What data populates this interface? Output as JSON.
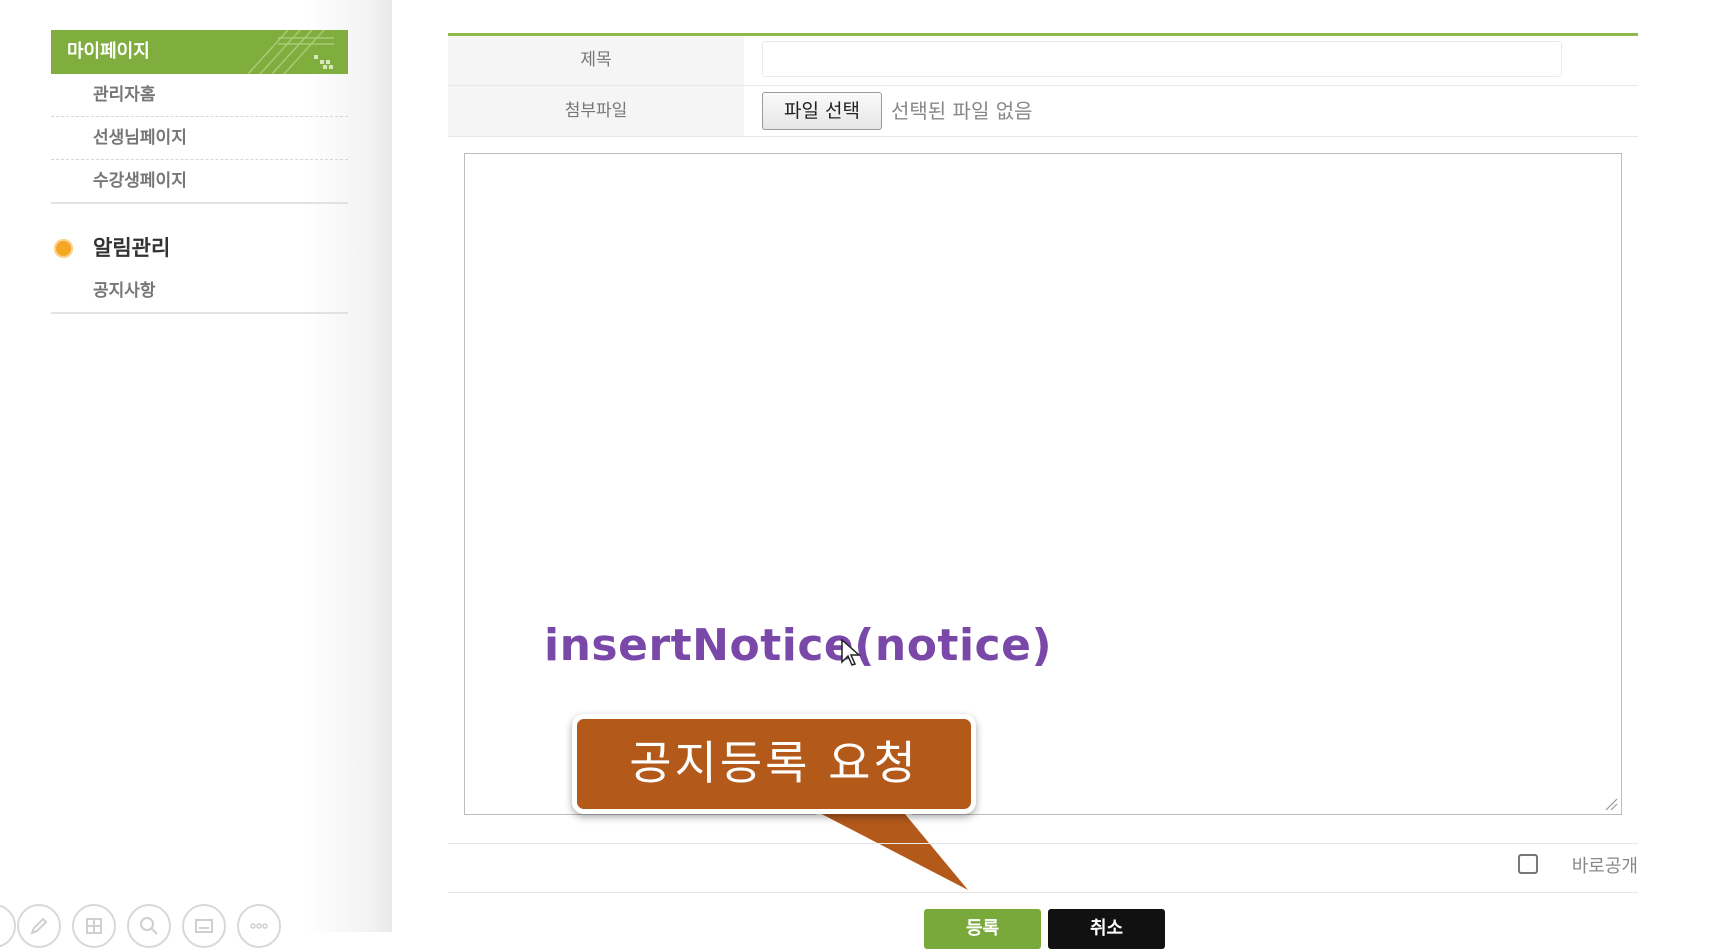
{
  "sidebar": {
    "header": "마이페이지",
    "items": [
      "관리자홈",
      "선생님페이지",
      "수강생페이지"
    ],
    "group_title": "알림관리",
    "group_items": [
      "공지사항"
    ]
  },
  "form": {
    "title_label": "제목",
    "title_value": "",
    "file_label": "첨부파일",
    "file_button": "파일 선택",
    "file_status": "선택된 파일 없음",
    "content_value": "",
    "publish_label": "바로공개",
    "publish_checked": false
  },
  "buttons": {
    "save": "등록",
    "cancel": "취소"
  },
  "annotation": {
    "code": "insertNotice(notice)",
    "callout": "공지등록 요청"
  },
  "colors": {
    "accent_green": "#7fae3e",
    "callout_brown": "#b3591a",
    "code_purple": "#7a48a8",
    "bullet_orange": "#f5a623"
  },
  "icons": [
    "pen-icon",
    "layout-icon",
    "zoom-icon",
    "subtitle-icon",
    "more-icon"
  ]
}
